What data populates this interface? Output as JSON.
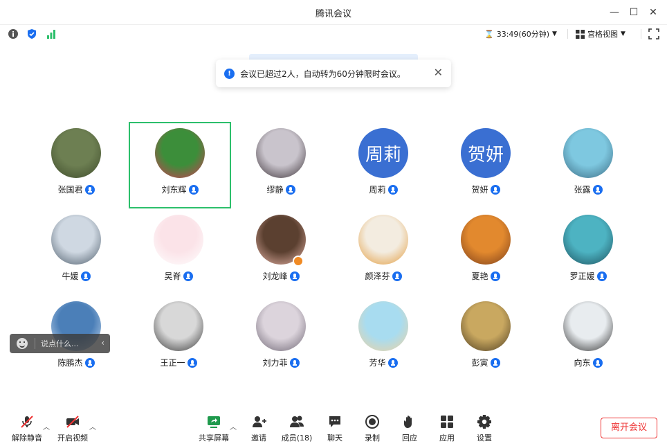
{
  "window": {
    "title": "腾讯会议"
  },
  "infobar": {
    "timer": "33:49(60分钟)",
    "view_mode": "宫格视图"
  },
  "notice": {
    "text": "会议已超过2人，自动转为60分钟限时会议。"
  },
  "participants": [
    {
      "name": "张国君",
      "avatar": "photo-man-outdoor",
      "colors": [
        "#6d7f52",
        "#3d4a2a"
      ]
    },
    {
      "name": "刘东辉",
      "avatar": "photo-garden-flowers",
      "colors": [
        "#3c8e3a",
        "#d23a55"
      ],
      "active": true
    },
    {
      "name": "缪静",
      "avatar": "photo-woman-portrait",
      "colors": [
        "#c9c4cc",
        "#3a3036"
      ]
    },
    {
      "name": "周莉",
      "avatar_text": "周莉"
    },
    {
      "name": "贺妍",
      "avatar_text": "贺妍"
    },
    {
      "name": "张露",
      "avatar": "photo-woman-rain-curtain",
      "colors": [
        "#7ec8e0",
        "#3a6a82"
      ]
    },
    {
      "name": "牛媛",
      "avatar": "photo-lake-sky",
      "colors": [
        "#cfd8e2",
        "#4b5a68"
      ]
    },
    {
      "name": "吴脊",
      "avatar": "cartoon-rabbit",
      "colors": [
        "#fbe3e8",
        "#ffffff"
      ]
    },
    {
      "name": "刘龙峰",
      "avatar": "cartoon-pig",
      "colors": [
        "#5b4030",
        "#e8b5a8"
      ],
      "host": true
    },
    {
      "name": "颜泽芬",
      "avatar": "illustration-leaf",
      "colors": [
        "#f3ece0",
        "#e29a3a"
      ]
    },
    {
      "name": "夏艳",
      "avatar": "photo-autumn-tree",
      "colors": [
        "#e2892e",
        "#7a3d1a"
      ]
    },
    {
      "name": "罗正媛",
      "avatar": "photo-mountain-lake",
      "colors": [
        "#4db3c2",
        "#1b4f5c"
      ]
    },
    {
      "name": "陈鹏杰",
      "avatar": "photo-clouds",
      "colors": [
        "#4b7fb8",
        "#cfe0f2"
      ]
    },
    {
      "name": "王正一",
      "avatar": "photo-statue-mask",
      "colors": [
        "#d8d8d8",
        "#333333"
      ]
    },
    {
      "name": "刘力菲",
      "avatar": "photo-misty-figure",
      "colors": [
        "#dcd4dc",
        "#6a6270"
      ]
    },
    {
      "name": "芳华",
      "avatar": "illustration-wind-chime",
      "colors": [
        "#a8dcf0",
        "#f0d2a0"
      ]
    },
    {
      "name": "彭寅",
      "avatar": "photo-metro-hall",
      "colors": [
        "#c9a860",
        "#4a3a20"
      ]
    },
    {
      "name": "向东",
      "avatar": "photo-man-glasses",
      "colors": [
        "#e8ecef",
        "#2a2a2a"
      ]
    }
  ],
  "chat": {
    "placeholder": "说点什么..."
  },
  "toolbar": {
    "unmute": "解除静音",
    "start_video": "开启视频",
    "share_screen": "共享屏幕",
    "invite": "邀请",
    "members": "成员(18)",
    "chat": "聊天",
    "record": "录制",
    "react": "回应",
    "apps": "应用",
    "settings": "设置",
    "leave": "离开会议"
  },
  "colors": {
    "accent": "#1a6ef0",
    "active_border": "#2cbf6b",
    "leave": "#ee3333",
    "share_icon": "#1f9a4d"
  }
}
